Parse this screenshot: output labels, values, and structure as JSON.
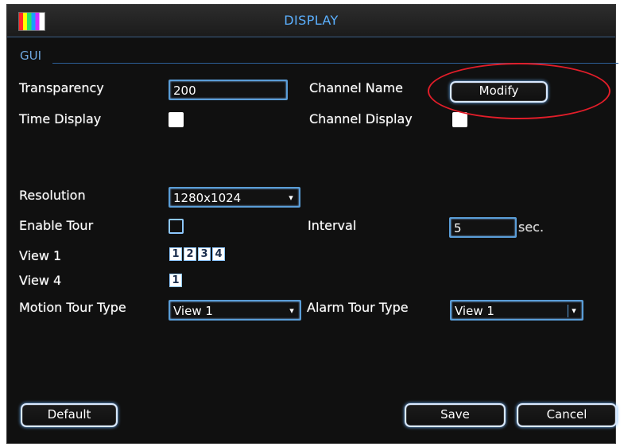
{
  "window": {
    "title": "DISPLAY"
  },
  "section": {
    "label": "GUI"
  },
  "transparency": {
    "label": "Transparency",
    "value": "200"
  },
  "channel_name": {
    "label": "Channel Name",
    "button": "Modify"
  },
  "time_display": {
    "label": "Time Display",
    "checked": true
  },
  "channel_display": {
    "label": "Channel Display",
    "checked": true
  },
  "resolution": {
    "label": "Resolution",
    "value": "1280x1024"
  },
  "enable_tour": {
    "label": "Enable Tour",
    "checked": false
  },
  "interval": {
    "label": "Interval",
    "value": "5",
    "unit": "sec."
  },
  "view1": {
    "label": "View 1",
    "options": [
      "1",
      "2",
      "3",
      "4"
    ]
  },
  "view4": {
    "label": "View 4",
    "options": [
      "1"
    ]
  },
  "motion_tour": {
    "label": "Motion Tour Type",
    "value": "View 1"
  },
  "alarm_tour": {
    "label": "Alarm Tour Type",
    "value": "View 1"
  },
  "buttons": {
    "default": "Default",
    "save": "Save",
    "cancel": "Cancel"
  },
  "colors": {
    "background": "#101010",
    "accent": "#5bb0ff",
    "annotation": "#e11d29"
  }
}
